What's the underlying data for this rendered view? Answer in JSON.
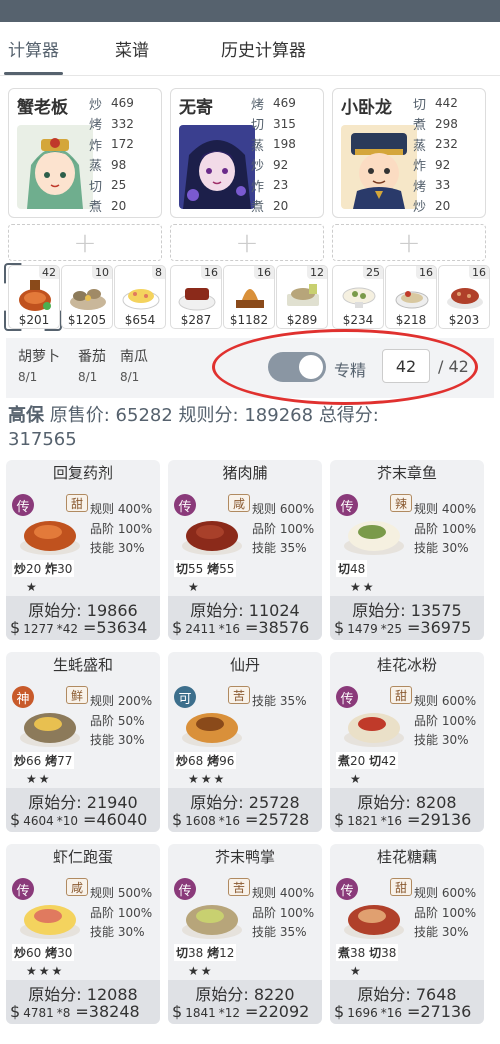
{
  "tabs": [
    "计算器",
    "菜谱",
    "历史计算器"
  ],
  "chefs": [
    {
      "name": "蟹老板",
      "skills": [
        [
          "炒",
          "469"
        ],
        [
          "烤",
          "332"
        ],
        [
          "炸",
          "172"
        ],
        [
          "蒸",
          "98"
        ],
        [
          "切",
          "25"
        ],
        [
          "煮",
          "20"
        ]
      ]
    },
    {
      "name": "无寄",
      "skills": [
        [
          "烤",
          "469"
        ],
        [
          "切",
          "315"
        ],
        [
          "蒸",
          "198"
        ],
        [
          "炒",
          "92"
        ],
        [
          "炸",
          "23"
        ],
        [
          "煮",
          "20"
        ]
      ]
    },
    {
      "name": "小卧龙",
      "skills": [
        [
          "切",
          "442"
        ],
        [
          "煮",
          "298"
        ],
        [
          "蒸",
          "232"
        ],
        [
          "炸",
          "92"
        ],
        [
          "烤",
          "33"
        ],
        [
          "炒",
          "20"
        ]
      ]
    }
  ],
  "add_symbol": "+",
  "dishes": [
    {
      "count": "42",
      "price": "$201"
    },
    {
      "count": "10",
      "price": "$1205"
    },
    {
      "count": "8",
      "price": "$654"
    },
    {
      "count": "16",
      "price": "$287"
    },
    {
      "count": "16",
      "price": "$1182"
    },
    {
      "count": "12",
      "price": "$289"
    },
    {
      "count": "25",
      "price": "$234"
    },
    {
      "count": "16",
      "price": "$218"
    },
    {
      "count": "16",
      "price": "$203"
    }
  ],
  "ingredients": [
    {
      "name": "胡萝卜",
      "qty": "8/1"
    },
    {
      "name": "番茄",
      "qty": "8/1"
    },
    {
      "name": "南瓜",
      "qty": "8/1"
    }
  ],
  "toggle_label": "专精",
  "toggle_on": true,
  "quantity_value": "42",
  "quantity_total": "/ 42",
  "summary": {
    "grade": "高保",
    "original_label": "原售价:",
    "original_value": "65282",
    "rule_label": "规则分:",
    "rule_value": "189268",
    "total_label": "总得分:",
    "total_value": "317565"
  },
  "recipes": [
    {
      "title": "回复药剂",
      "rarity": "传",
      "flavor": "甜",
      "stats": [
        "规则 400%",
        "品阶 100%",
        "技能 30%"
      ],
      "skills": [
        [
          "炒",
          "20"
        ],
        [
          "炸",
          "30"
        ]
      ],
      "stars": "★",
      "orig": "原始分: 19866",
      "unit": "1277",
      "mult": "*42",
      "result": "=53634"
    },
    {
      "title": "猪肉脯",
      "rarity": "传",
      "flavor": "咸",
      "stats": [
        "规则 600%",
        "品阶 100%",
        "技能 35%"
      ],
      "skills": [
        [
          "切",
          "55"
        ],
        [
          "烤",
          "55"
        ]
      ],
      "stars": "★",
      "orig": "原始分: 11024",
      "unit": "2411",
      "mult": "*16",
      "result": "=38576"
    },
    {
      "title": "芥末章鱼",
      "rarity": "传",
      "flavor": "辣",
      "stats": [
        "规则 400%",
        "品阶 100%",
        "技能 30%"
      ],
      "skills": [
        [
          "切",
          "48"
        ]
      ],
      "stars": "★★",
      "orig": "原始分: 13575",
      "unit": "1479",
      "mult": "*25",
      "result": "=36975"
    },
    {
      "title": "生蚝盛和",
      "rarity": "神",
      "flavor": "鲜",
      "stats": [
        "规则 200%",
        "品阶 50%",
        "技能 30%"
      ],
      "skills": [
        [
          "炒",
          "66"
        ],
        [
          "烤",
          "77"
        ]
      ],
      "stars": "★★",
      "orig": "原始分: 21940",
      "unit": "4604",
      "mult": "*10",
      "result": "=46040"
    },
    {
      "title": "仙丹",
      "rarity": "可",
      "flavor": "苦",
      "stats": [
        "技能 35%"
      ],
      "skills": [
        [
          "炒",
          "68"
        ],
        [
          "烤",
          "96"
        ]
      ],
      "stars": "★★★",
      "orig": "原始分: 25728",
      "unit": "1608",
      "mult": "*16",
      "result": "=25728"
    },
    {
      "title": "桂花冰粉",
      "rarity": "传",
      "flavor": "甜",
      "stats": [
        "规则 600%",
        "品阶 100%",
        "技能 30%"
      ],
      "skills": [
        [
          "煮",
          "20"
        ],
        [
          "切",
          "42"
        ]
      ],
      "stars": "★",
      "orig": "原始分: 8208",
      "unit": "1821",
      "mult": "*16",
      "result": "=29136"
    },
    {
      "title": "虾仁跑蛋",
      "rarity": "传",
      "flavor": "咸",
      "stats": [
        "规则 500%",
        "品阶 100%",
        "技能 30%"
      ],
      "skills": [
        [
          "炒",
          "60"
        ],
        [
          "烤",
          "30"
        ]
      ],
      "stars": "★★★",
      "orig": "原始分: 12088",
      "unit": "4781",
      "mult": "*8",
      "result": "=38248"
    },
    {
      "title": "芥末鸭掌",
      "rarity": "传",
      "flavor": "苦",
      "stats": [
        "规则 400%",
        "品阶 100%",
        "技能 35%"
      ],
      "skills": [
        [
          "切",
          "38"
        ],
        [
          "烤",
          "12"
        ]
      ],
      "stars": "★★",
      "orig": "原始分: 8220",
      "unit": "1841",
      "mult": "*12",
      "result": "=22092"
    },
    {
      "title": "桂花糖藕",
      "rarity": "传",
      "flavor": "甜",
      "stats": [
        "规则 600%",
        "品阶 100%",
        "技能 30%"
      ],
      "skills": [
        [
          "煮",
          "38"
        ],
        [
          "切",
          "38"
        ]
      ],
      "stars": "★",
      "orig": "原始分: 7648",
      "unit": "1696",
      "mult": "*16",
      "result": "=27136"
    }
  ],
  "currency": "$",
  "colors": {
    "accent": "#56626e",
    "highlight": "#e0312f",
    "card_bg": "#f0f1f3"
  }
}
